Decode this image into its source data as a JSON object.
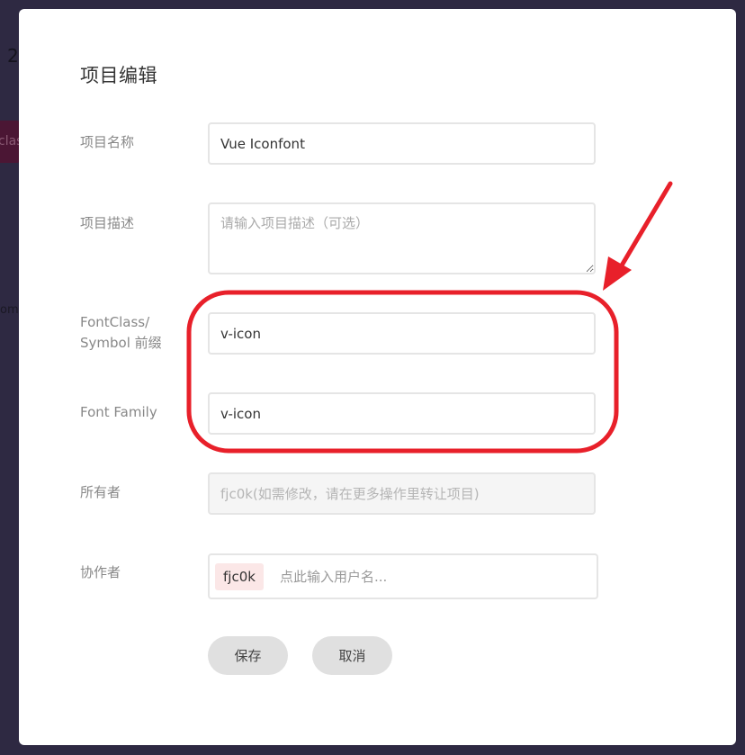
{
  "background": {
    "number_fragment": "2",
    "pill_fragment": "clas",
    "side_fragment": "om"
  },
  "modal": {
    "title": "项目编辑"
  },
  "form": {
    "name": {
      "label": "项目名称",
      "value": "Vue Iconfont"
    },
    "description": {
      "label": "项目描述",
      "placeholder": "请输入项目描述（可选）"
    },
    "font_class_prefix": {
      "label_line1": "FontClass/",
      "label_line2": "Symbol 前缀",
      "value": "v-icon"
    },
    "font_family": {
      "label": "Font Family",
      "value": "v-icon"
    },
    "owner": {
      "label": "所有者",
      "placeholder": "fjc0k(如需修改，请在更多操作里转让项目)"
    },
    "collaborators": {
      "label": "协作者",
      "tags": [
        "fjc0k"
      ],
      "placeholder": "点此输入用户名..."
    }
  },
  "buttons": {
    "save": "保存",
    "cancel": "取消"
  },
  "colors": {
    "backdrop": "#2e2942",
    "annotation_red": "#e8202a",
    "tag_bg": "#fbe7e7",
    "button_bg": "#e0e0e0"
  }
}
